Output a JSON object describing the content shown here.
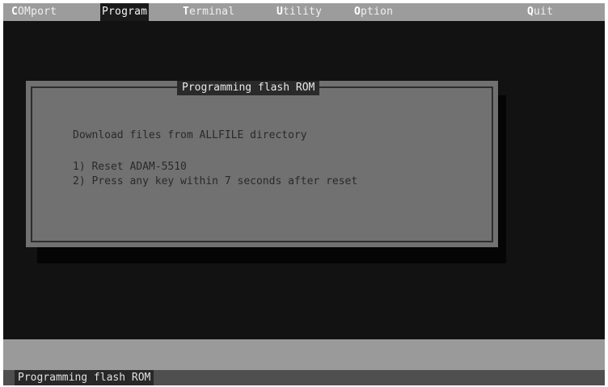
{
  "menu": {
    "items": [
      {
        "hotkey": "C",
        "rest": "OMport"
      },
      {
        "hotkey": "",
        "rest": "Program"
      },
      {
        "hotkey": "T",
        "rest": "erminal"
      },
      {
        "hotkey": "U",
        "rest": "tility"
      },
      {
        "hotkey": "O",
        "rest": "ption"
      },
      {
        "hotkey": "Q",
        "rest": "uit"
      }
    ]
  },
  "dialog": {
    "title": "Programming flash ROM",
    "instruction": "Download files from ALLFILE directory",
    "steps": [
      "1) Reset ADAM-5510",
      "2) Press any key within 7 seconds after reset"
    ]
  },
  "status": {
    "text": "Programming flash ROM"
  }
}
